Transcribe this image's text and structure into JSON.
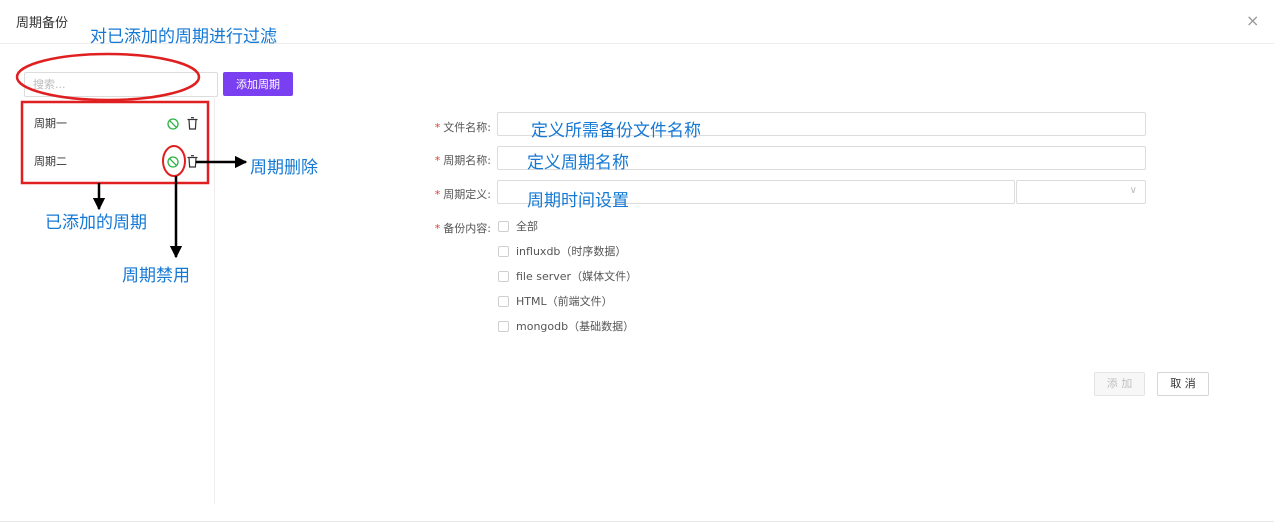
{
  "dialog": {
    "title": "周期备份",
    "close_glyph": "×"
  },
  "sidebar": {
    "search_placeholder": "搜索...",
    "add_button": "添加周期",
    "cycles": [
      {
        "label": "周期一"
      },
      {
        "label": "周期二"
      }
    ]
  },
  "form": {
    "required_mark": "*",
    "file_name_label": "文件名称:",
    "cycle_name_label": "周期名称:",
    "cycle_def_label": "周期定义:",
    "content_label": "备份内容:",
    "select_arrow": "∨",
    "options": [
      {
        "label": "全部"
      },
      {
        "label": "influxdb（时序数据）"
      },
      {
        "label": "file server（媒体文件）"
      },
      {
        "label": "HTML（前端文件）"
      },
      {
        "label": "mongodb（基础数据）"
      }
    ],
    "add_button": "添 加",
    "cancel_button": "取 消"
  },
  "annotations": {
    "filter": "对已添加的周期进行过滤",
    "added_cycles": "已添加的周期",
    "delete": "周期删除",
    "disable": "周期禁用",
    "file_name_hint": "定义所需备份文件名称",
    "cycle_name_hint": "定义周期名称",
    "time_hint": "周期时间设置"
  },
  "colors": {
    "accent": "#7b3ff2",
    "annotation_text": "#1478d4",
    "annotation_marker": "#e02020",
    "enabled_icon": "#2fb344",
    "required": "#e53935"
  },
  "icons": [
    "ban-icon",
    "trash-icon",
    "close-icon",
    "chevron-down-icon"
  ]
}
